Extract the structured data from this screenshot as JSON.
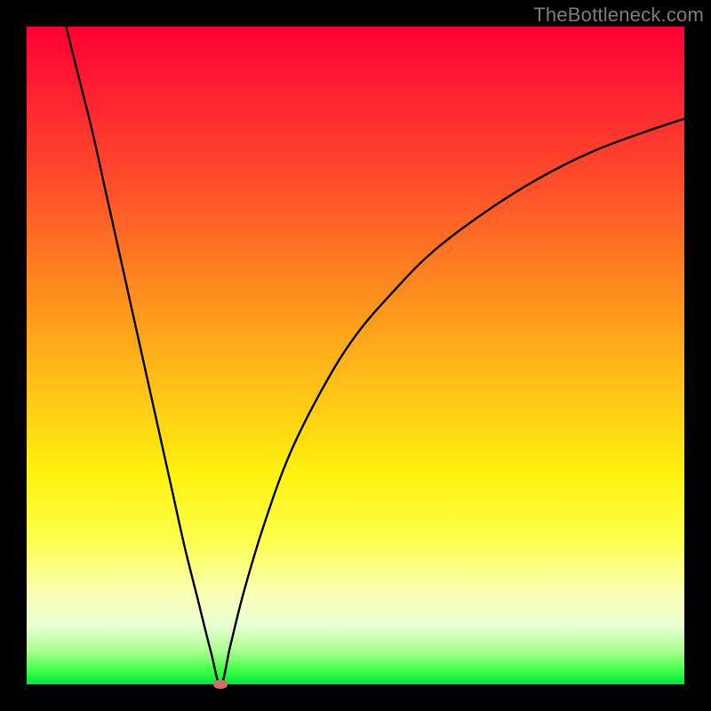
{
  "watermark": "TheBottleneck.com",
  "chart_data": {
    "type": "line",
    "title": "",
    "xlabel": "",
    "ylabel": "",
    "xlim": [
      0,
      100
    ],
    "ylim": [
      0,
      100
    ],
    "grid": false,
    "legend": false,
    "series": [
      {
        "name": "left-branch",
        "x": [
          6,
          8,
          10,
          12,
          14,
          16,
          18,
          20,
          22,
          24,
          26,
          28,
          29.5
        ],
        "values": [
          100,
          92,
          84,
          75,
          66,
          57,
          48,
          39,
          30,
          21,
          13,
          5,
          0
        ]
      },
      {
        "name": "right-branch",
        "x": [
          29.5,
          31,
          33,
          36,
          40,
          45,
          50,
          56,
          62,
          70,
          78,
          86,
          94,
          100
        ],
        "values": [
          0,
          6,
          14,
          24,
          35,
          45,
          53,
          60,
          66,
          72,
          77,
          81,
          84,
          86
        ]
      }
    ],
    "marker": {
      "x": 29.5,
      "y": 0,
      "color": "#d46a6a"
    },
    "background_gradient": {
      "top": "#ff0033",
      "mid": "#ffd400",
      "bottom": "#00e63f"
    }
  }
}
